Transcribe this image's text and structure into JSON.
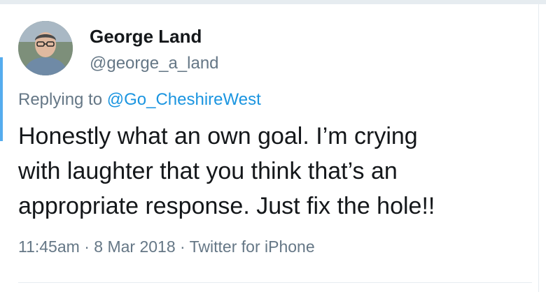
{
  "author": {
    "name": "George Land",
    "handle": "@george_a_land",
    "avatar_icon": "profile-photo"
  },
  "reply": {
    "prefix": "Replying to ",
    "mention": "@Go_CheshireWest"
  },
  "tweet": {
    "lines": [
      "Honestly what an own goal. I’m crying",
      "with laughter that you think that’s an",
      "appropriate response. Just fix the hole!!"
    ]
  },
  "meta": {
    "time": "11:45am",
    "separator_1": " · ",
    "date": "8 Mar 2018",
    "separator_2": " · ",
    "source": "Twitter for iPhone"
  },
  "colors": {
    "text": "#14171a",
    "secondary": "#657786",
    "link": "#1b95e0",
    "accent": "#55acee"
  }
}
